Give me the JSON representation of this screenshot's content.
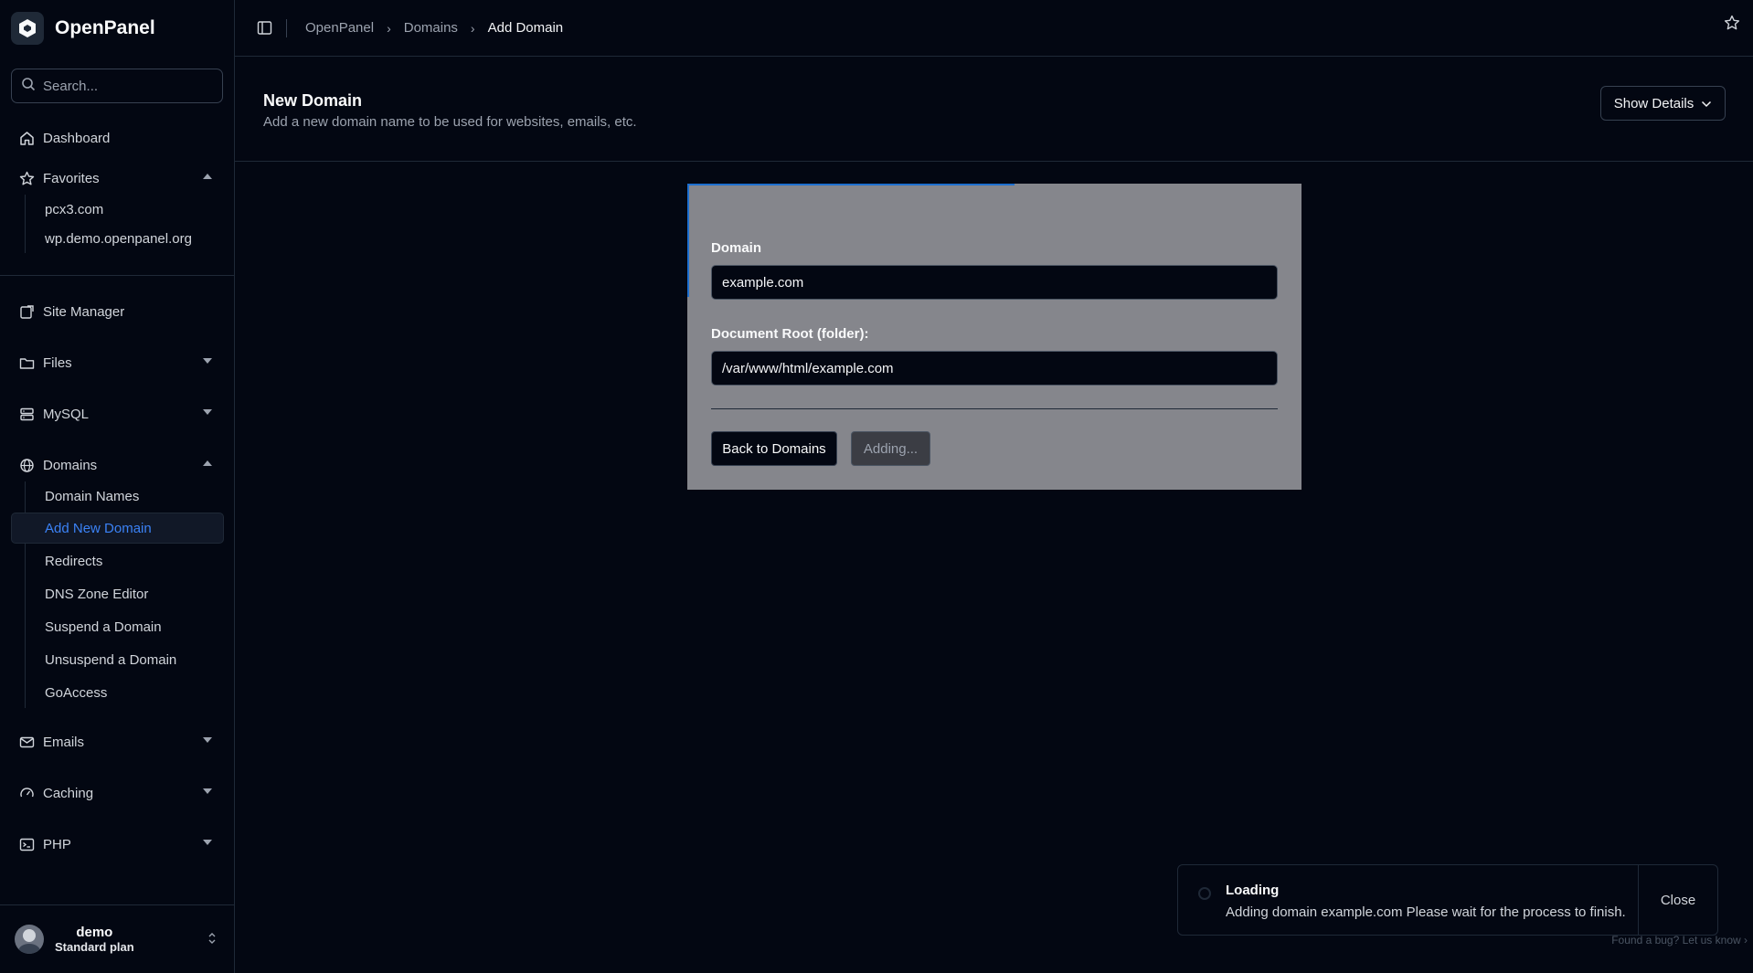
{
  "app": {
    "name": "OpenPanel"
  },
  "search": {
    "placeholder": "Search..."
  },
  "sidebar": {
    "dashboard": "Dashboard",
    "favorites": {
      "label": "Favorites",
      "items": [
        "pcx3.com",
        "wp.demo.openpanel.org"
      ]
    },
    "site_manager": "Site Manager",
    "files": "Files",
    "mysql": "MySQL",
    "domains": {
      "label": "Domains",
      "items": [
        "Domain Names",
        "Add New Domain",
        "Redirects",
        "DNS Zone Editor",
        "Suspend a Domain",
        "Unsuspend a Domain",
        "GoAccess"
      ]
    },
    "emails": "Emails",
    "caching": "Caching",
    "php": "PHP"
  },
  "user": {
    "name": "demo",
    "plan": "Standard plan"
  },
  "breadcrumb": [
    "OpenPanel",
    "Domains",
    "Add Domain"
  ],
  "page": {
    "title": "New Domain",
    "subtitle": "Add a new domain name to be used for websites, emails, etc.",
    "details_button": "Show Details"
  },
  "form": {
    "domain_label": "Domain",
    "domain_value": "example.com",
    "docroot_label": "Document Root (folder):",
    "docroot_value": "/var/www/html/example.com",
    "back_button": "Back to Domains",
    "submit_button": "Adding..."
  },
  "toast": {
    "title": "Loading",
    "message": "Adding domain example.com Please wait for the process to finish.",
    "close": "Close"
  },
  "footer": {
    "bug_link": "Found a bug? Let us know"
  },
  "colors": {
    "accent": "#3b82f6",
    "background": "#030712",
    "card": "#85868c"
  }
}
